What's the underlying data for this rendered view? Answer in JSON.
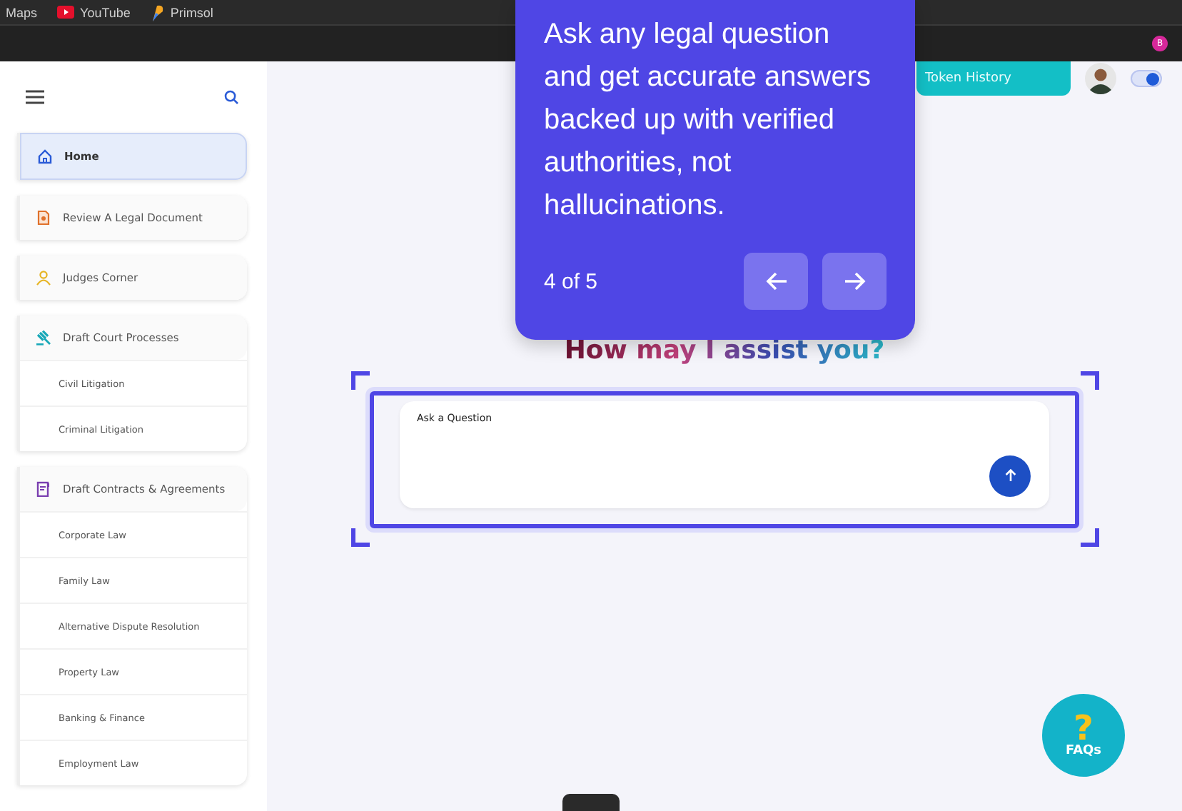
{
  "browser": {
    "bookmarks": [
      {
        "label": "Maps"
      },
      {
        "label": "YouTube"
      },
      {
        "label": "Primsol"
      }
    ],
    "profile": "B"
  },
  "sidebar": {
    "items": [
      {
        "label": "Home",
        "selected": true
      },
      {
        "label": "Review A Legal Document",
        "selected": false
      },
      {
        "label": "Judges Corner",
        "selected": false
      },
      {
        "label": "Draft Court Processes",
        "selected": false,
        "children": [
          {
            "label": "Civil Litigation"
          },
          {
            "label": "Criminal Litigation"
          }
        ]
      },
      {
        "label": "Draft Contracts & Agreements",
        "selected": false,
        "children": [
          {
            "label": "Corporate Law"
          },
          {
            "label": "Family Law"
          },
          {
            "label": "Alternative Dispute Resolution"
          },
          {
            "label": "Property Law"
          },
          {
            "label": "Banking & Finance"
          },
          {
            "label": "Employment Law"
          }
        ]
      }
    ]
  },
  "header": {
    "token_history_button": "Token History",
    "toggle": {
      "on": true
    }
  },
  "main": {
    "heading": "How may I assist you?",
    "question_field": {
      "placeholder": "Ask a Question"
    }
  },
  "tour": {
    "text": "Ask any legal question and get accurate answers backed up with verified authorities, not hallucinations.",
    "step": "4 of 5"
  },
  "faq_button": {
    "mark": "?",
    "label": "FAQs"
  }
}
